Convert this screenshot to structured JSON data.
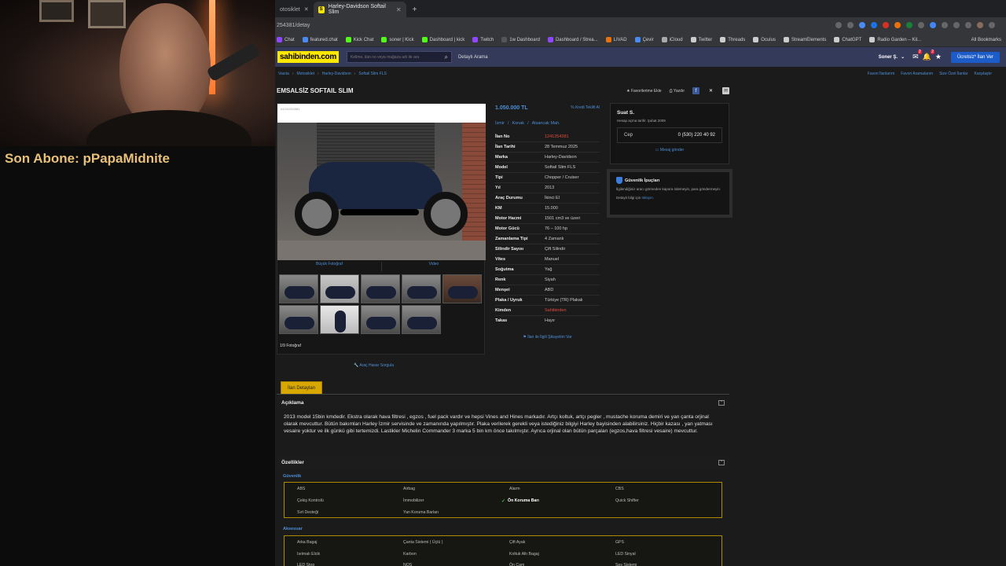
{
  "overlay": {
    "sub_label": "Son Abone: pPapaMidnite"
  },
  "browser": {
    "tabs": [
      {
        "label": "otosiklet"
      },
      {
        "label": "Harley-Davidson Softail Slim",
        "active": true
      }
    ],
    "url": "254381/detay",
    "bookmarks": [
      "Chat",
      "featured.chat",
      "Kick Chat",
      "soner | Kick",
      "Dashboard | kick",
      "Twitch",
      "1w Dashboard",
      "Dashboard / Strea...",
      "LIVAD",
      "Çevir",
      "iCloud",
      "Twitter",
      "Threads",
      "Oculus",
      "StreamElements",
      "ChatGPT",
      "Radio Garden – Kil..."
    ],
    "all_bookmarks": "All Bookmarks"
  },
  "header": {
    "logo": "sahibinden.com",
    "search_placeholder": "Kelime, ilan no veya mağaza adı ile ara",
    "detailed_search": "Detaylı Arama",
    "user": "Soner Ş.",
    "msg_badge": "2",
    "notif_badge": "2",
    "free_ad": "Ücretsiz* İlan Ver"
  },
  "breadcrumb": [
    "Vasıta",
    "Motosiklet",
    "Harley-Davidson",
    "Softail Slim FLS"
  ],
  "quicklinks": [
    "Favori İlanlarım",
    "Favori Aramalarım",
    "Size Özel İlanlar",
    "Karşılaştır"
  ],
  "listing": {
    "title": "EMSALSİZ SOFTAIL SLIM",
    "add_favorite": "Favorilerime Ekle",
    "print": "Yazdır",
    "ilan_tag": "#1241254381",
    "big_photo": "Büyük Fotoğraf",
    "video": "Video",
    "photo_count": "1/9 Fotoğraf",
    "damage_query": "Araç Hasar Sorgula",
    "price": "1.050.000 TL",
    "credit": "Kredi Teklifi Al",
    "location": [
      "İzmir",
      "Konak",
      "Alsancak Mah."
    ],
    "specs": [
      {
        "k": "İlan No",
        "v": "1241254381",
        "red": true
      },
      {
        "k": "İlan Tarihi",
        "v": "28 Temmuz 2025"
      },
      {
        "k": "Marka",
        "v": "Harley-Davidson"
      },
      {
        "k": "Model",
        "v": "Softail Slim FLS"
      },
      {
        "k": "Tipi",
        "v": "Chopper / Cruiser"
      },
      {
        "k": "Yıl",
        "v": "2013"
      },
      {
        "k": "Araç Durumu",
        "v": "İkinci El"
      },
      {
        "k": "KM",
        "v": "15.000"
      },
      {
        "k": "Motor Hacmi",
        "v": "1501 cm3 ve üzeri"
      },
      {
        "k": "Motor Gücü",
        "v": "76 – 100 hp"
      },
      {
        "k": "Zamanlama Tipi",
        "v": "4 Zamanlı"
      },
      {
        "k": "Silindir Sayısı",
        "v": "Çift Silindir"
      },
      {
        "k": "Vites",
        "v": "Manuel"
      },
      {
        "k": "Soğutma",
        "v": "Yağ"
      },
      {
        "k": "Renk",
        "v": "Siyah"
      },
      {
        "k": "Menşei",
        "v": "ABD"
      },
      {
        "k": "Plaka / Uyruk",
        "v": "Türkiye (TR) Plakalı"
      },
      {
        "k": "Kimden",
        "v": "Sahibinden",
        "red": true
      },
      {
        "k": "Takas",
        "v": "Hayır"
      }
    ],
    "complain": "İlan ile İlgili Şikayetim Var"
  },
  "seller": {
    "name": "Suat S.",
    "since": "Hesap açma tarihi: Şubat 2009",
    "phone_label": "Cep",
    "phone": "0 (530) 220 40 92",
    "message": "Mesaj gönder"
  },
  "tips": {
    "title": "Güvenlik İpuçları",
    "text": "İlgilendiğiniz aracı görmeden kapora ödemeyin, para göndermeyin.",
    "more_prefix": "Detaylı bilgi için ",
    "more_link": "tıklayın."
  },
  "details": {
    "tab": "İlan Detayları",
    "desc_title": "Açıklama",
    "description": "2013 model 15bin kmdedir. Ekstra olarak hava filtresi , egzos , fuel pack vardır ve hepsi Vines and Hines markadır. Artçı koltuk, artçı pegler , mustache koruma demiri ve yan çanta orjinal olarak mevcuttur. Bütün bakımları Harley İzmir servisinde ve zamanında yapılmıştır. Plaka verilerek gerekli veya istediğiniz bilgiyi Harley bayisinden alabilirsiniz. Hiçbir kazası , yan yatması vesaire yoktur ve ilk günkü gibi tertemizdi. Lastikler Michelin Commander 3 marka 5 bin km önce takılmıştır. Ayrıca orjinal olan bütün parçaları (egzos,hava filtresi vesaire) mevcuttur.",
    "features_title": "Özellikler",
    "groups": [
      {
        "label": "Güvenlik",
        "items": [
          {
            "t": "ABS"
          },
          {
            "t": "Airbag"
          },
          {
            "t": "Alarm"
          },
          {
            "t": "CBS"
          },
          {
            "t": "Çekiş Kontrolü"
          },
          {
            "t": "İmmobilizer"
          },
          {
            "t": "Ön Koruma Barı",
            "on": true
          },
          {
            "t": "Quick Shifter"
          },
          {
            "t": "Sırt Desteği"
          },
          {
            "t": "Yan Koruma Barları"
          }
        ]
      },
      {
        "label": "Aksesuar",
        "items": [
          {
            "t": "Arka Bagaj"
          },
          {
            "t": "Çanta Sistemi ( Üçlü )"
          },
          {
            "t": "Çift Ayak"
          },
          {
            "t": "GPS"
          },
          {
            "t": "Isıtmalı Elcik"
          },
          {
            "t": "Karbon"
          },
          {
            "t": "Koltuk Altı Bagaj"
          },
          {
            "t": "LED Sinyal"
          },
          {
            "t": "LED Stop"
          },
          {
            "t": "NOS"
          },
          {
            "t": "Ön Cam"
          },
          {
            "t": "Ses Sistemi"
          }
        ]
      }
    ]
  }
}
